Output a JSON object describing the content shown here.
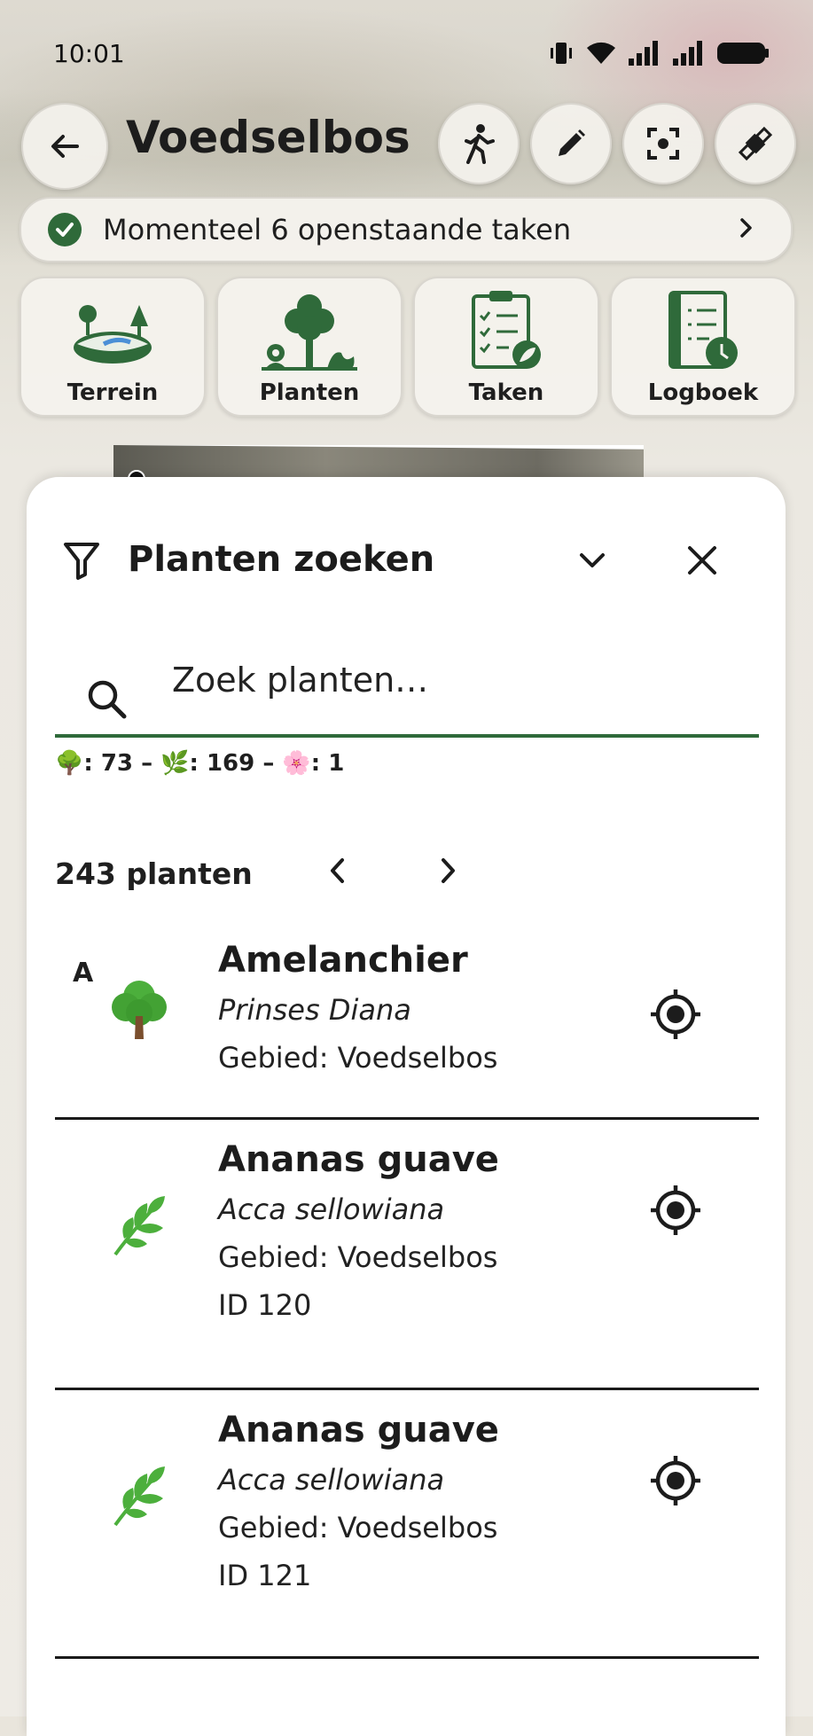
{
  "status_bar": {
    "time": "10:01"
  },
  "header": {
    "title": "Voedselbos",
    "actions": [
      "walk-icon",
      "edit-icon",
      "focus-icon",
      "satellite-icon"
    ]
  },
  "tasks_banner": {
    "text": "Momenteel 6 openstaande taken"
  },
  "tiles": [
    {
      "label": "Terrein",
      "icon": "terrain-icon"
    },
    {
      "label": "Planten",
      "icon": "plants-icon"
    },
    {
      "label": "Taken",
      "icon": "tasks-icon"
    },
    {
      "label": "Logboek",
      "icon": "logbook-icon"
    }
  ],
  "search_panel": {
    "title": "Planten zoeken",
    "search_placeholder": "Zoek planten…",
    "search_value": "",
    "counts": {
      "trees_emoji": "🌳",
      "trees": "73",
      "herbs_emoji": "🌿",
      "herbs": "169",
      "flowers_emoji": "🌸",
      "flowers": "1",
      "separator": "–"
    },
    "result_count": "243 planten"
  },
  "plants": [
    {
      "group_letter": "A",
      "emoji": "🌳",
      "name": "Amelanchier",
      "latin": "Prinses Diana",
      "area": "Gebied: Voedselbos",
      "id": ""
    },
    {
      "group_letter": "",
      "emoji": "🌿",
      "name": "Ananas guave",
      "latin": "Acca sellowiana",
      "area": "Gebied: Voedselbos",
      "id": "ID 120"
    },
    {
      "group_letter": "",
      "emoji": "🌿",
      "name": "Ananas guave",
      "latin": "Acca sellowiana",
      "area": "Gebied: Voedselbos",
      "id": "ID 121"
    }
  ],
  "colors": {
    "accent": "#2f6a3a",
    "text": "#1c1c1c",
    "surface": "#ffffff"
  }
}
